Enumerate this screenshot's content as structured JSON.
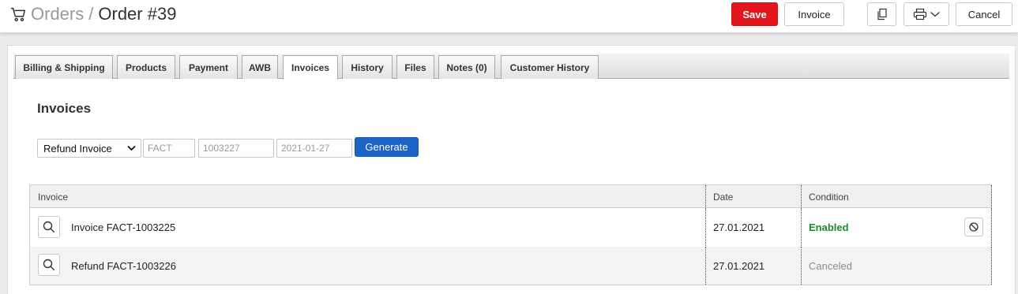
{
  "header": {
    "breadcrumb_parent": "Orders",
    "breadcrumb_separator": "/",
    "breadcrumb_current": "Order #39",
    "save_label": "Save",
    "invoice_label": "Invoice",
    "cancel_label": "Cancel",
    "accent_color": "#e2161c"
  },
  "tabs": [
    {
      "label": "Billing & Shipping",
      "active": false
    },
    {
      "label": "Products",
      "active": false
    },
    {
      "label": "Payment",
      "active": false
    },
    {
      "label": "AWB",
      "active": false
    },
    {
      "label": "Invoices",
      "active": true
    },
    {
      "label": "History",
      "active": false
    },
    {
      "label": "Files",
      "active": false
    },
    {
      "label": "Notes (0)",
      "active": false
    },
    {
      "label": "Customer History",
      "active": false
    }
  ],
  "invoices_section": {
    "title": "Invoices",
    "form": {
      "type_selected": "Refund Invoice",
      "series_placeholder": "FACT",
      "number_placeholder": "1003227",
      "date_placeholder": "2021-01-27",
      "generate_label": "Generate",
      "generate_color": "#1a63c7"
    },
    "table": {
      "columns": [
        "Invoice",
        "Date",
        "Condition"
      ],
      "rows": [
        {
          "invoice": "Invoice FACT-1003225",
          "date": "27.01.2021",
          "condition": "Enabled",
          "condition_color": "#1d8a2a"
        },
        {
          "invoice": "Refund FACT-1003226",
          "date": "27.01.2021",
          "condition": "Canceled",
          "condition_color": "#8c8c8c"
        }
      ]
    }
  }
}
